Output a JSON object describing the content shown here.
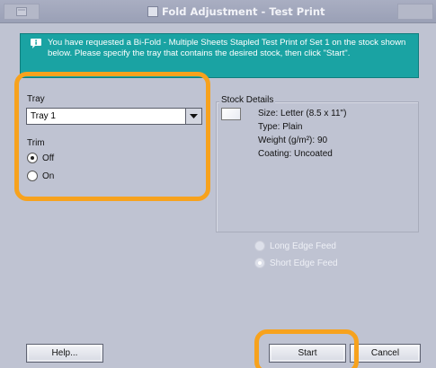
{
  "window": {
    "title": "Fold Adjustment - Test Print"
  },
  "banner": {
    "icon": "info-bubble-icon",
    "message": "You have requested a Bi-Fold - Multiple Sheets Stapled Test Print of Set 1 on the stock shown below. Please specify the tray that contains the desired stock, then click \"Start\"."
  },
  "tray": {
    "label": "Tray",
    "selected": "Tray 1"
  },
  "trim": {
    "label": "Trim",
    "options": [
      {
        "label": "Off",
        "selected": true
      },
      {
        "label": "On",
        "selected": false
      }
    ]
  },
  "stock_details": {
    "legend": "Stock Details",
    "lines": [
      "Size: Letter (8.5 x 11\")",
      "Type: Plain",
      "Weight (g/m²): 90",
      "Coating: Uncoated"
    ]
  },
  "feed": {
    "options": [
      {
        "label": "Long Edge Feed",
        "selected": false
      },
      {
        "label": "Short Edge Feed",
        "selected": true
      }
    ]
  },
  "buttons": {
    "help": "Help...",
    "start": "Start",
    "cancel": "Cancel"
  },
  "colors": {
    "window_bg": "#bfc3d2",
    "banner_bg": "#1aa3a3",
    "highlight": "#f7a21d"
  }
}
